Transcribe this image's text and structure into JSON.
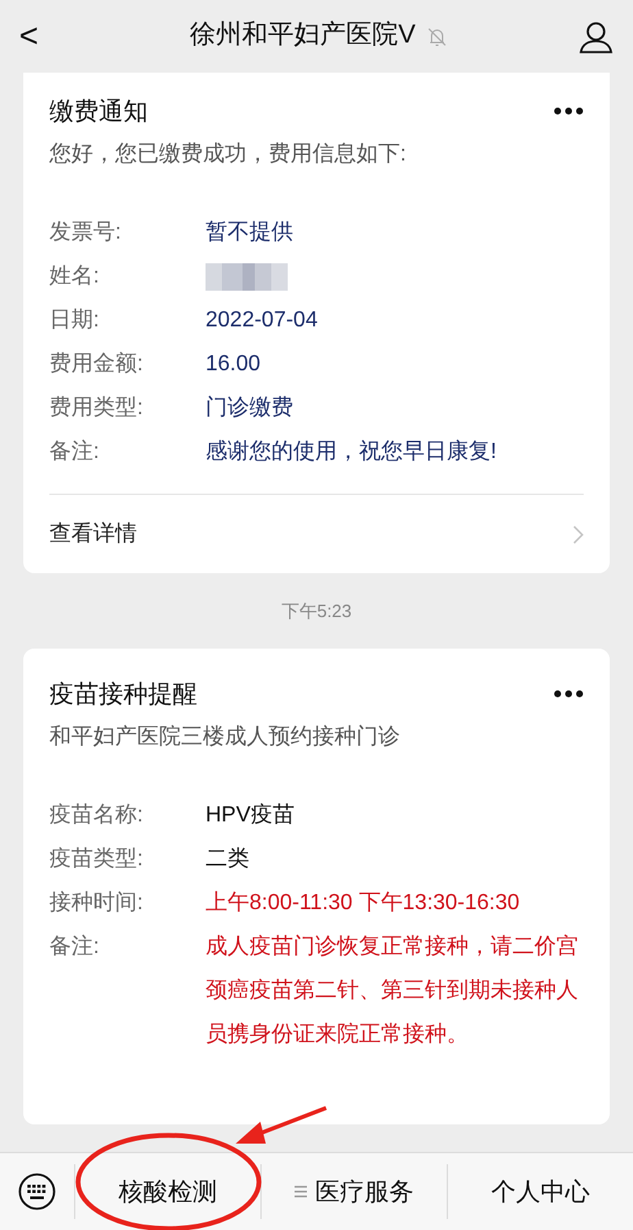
{
  "header": {
    "back": "<",
    "title": "徐州和平妇产医院V",
    "muted": true
  },
  "messages": [
    {
      "kind": "card",
      "title": "缴费通知",
      "subtitle": "您好，您已缴费成功，费用信息如下:",
      "top_cut": true,
      "rows": [
        {
          "label": "发票号:",
          "value": "暂不提供",
          "color": "#1c2d6b"
        },
        {
          "label": "姓名:",
          "kind": "blurred"
        },
        {
          "label": "日期:",
          "value": "2022-07-04",
          "color": "#1c2d6b"
        },
        {
          "label": "费用金额:",
          "value": "16.00",
          "color": "#1c2d6b"
        },
        {
          "label": "费用类型:",
          "value": "门诊缴费",
          "color": "#1c2d6b"
        },
        {
          "label": "备注:",
          "value": "感谢您的使用，祝您早日康复!",
          "color": "#1c2d6b"
        }
      ],
      "footer": "查看详情"
    },
    {
      "kind": "time",
      "text": "下午5:23"
    },
    {
      "kind": "card",
      "title": "疫苗接种提醒",
      "subtitle": "和平妇产医院三楼成人预约接种门诊",
      "top_cut": false,
      "rows": [
        {
          "label": "疫苗名称:",
          "value": "HPV疫苗",
          "color": "#111111"
        },
        {
          "label": "疫苗类型:",
          "value": "二类",
          "color": "#111111"
        },
        {
          "label": "接种时间:",
          "value": "上午8:00-11:30  下午13:30-16:30",
          "color": "#d0121b"
        },
        {
          "label": "备注:",
          "value": "成人疫苗门诊恢复正常接种，请二价宫颈癌疫苗第二针、第三针到期未接种人员携身份证来院正常接种。",
          "color": "#d0121b"
        }
      ]
    }
  ],
  "menu": [
    {
      "label": "核酸检测",
      "has_submenu": false
    },
    {
      "label": "医疗服务",
      "has_submenu": true
    },
    {
      "label": "个人中心",
      "has_submenu": false
    }
  ],
  "annotation": {
    "kind": "circle_arrow"
  }
}
